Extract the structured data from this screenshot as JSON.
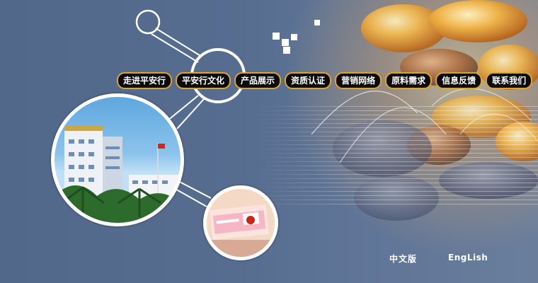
{
  "nav": {
    "items": [
      {
        "label": "走进平安行"
      },
      {
        "label": "平安行文化"
      },
      {
        "label": "产品展示"
      },
      {
        "label": "资质认证"
      },
      {
        "label": "营销网络"
      },
      {
        "label": "原料需求"
      },
      {
        "label": "信息反馈"
      },
      {
        "label": "联系我们"
      }
    ]
  },
  "language": {
    "chinese_label": "中文版",
    "english_label": "EngLish"
  },
  "colors": {
    "background": "#52688a",
    "nav_border": "#e0a32a",
    "nav_fill": "#0a0a0a"
  }
}
